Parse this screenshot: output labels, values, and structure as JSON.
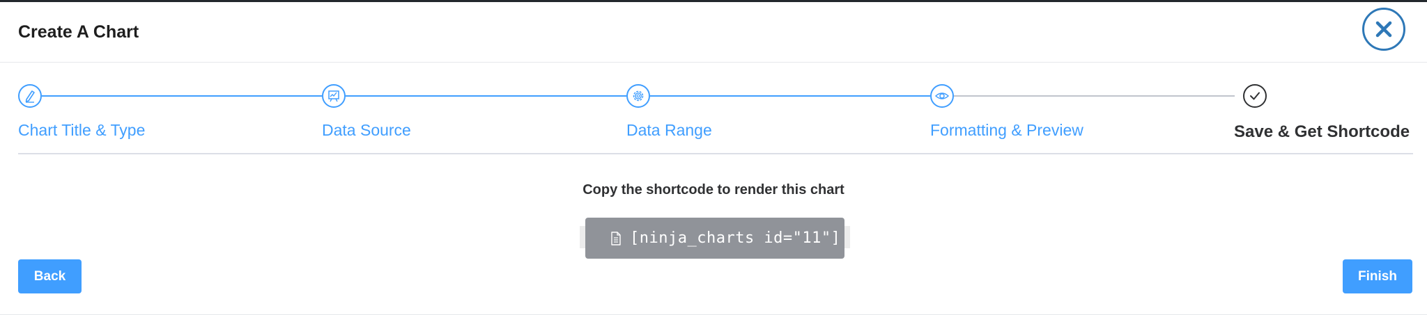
{
  "dialog": {
    "title": "Create A Chart",
    "close_icon": "close-icon",
    "accent_color": "#409eff",
    "close_color": "#2e78b7"
  },
  "steps": [
    {
      "label": "Chart Title & Type",
      "icon": "pencil-icon",
      "status": "complete"
    },
    {
      "label": "Data Source",
      "icon": "presentation-chart-icon",
      "status": "complete"
    },
    {
      "label": "Data Range",
      "icon": "gear-icon",
      "status": "complete"
    },
    {
      "label": "Formatting & Preview",
      "icon": "eye-icon",
      "status": "complete"
    },
    {
      "label": "Save & Get Shortcode",
      "icon": "check-circle-icon",
      "status": "current"
    }
  ],
  "content": {
    "copy_label": "Copy the shortcode to render this chart",
    "shortcode": "[ninja_charts id=\"11\"]",
    "shortcode_icon": "document-icon"
  },
  "actions": {
    "back_label": "Back",
    "finish_label": "Finish"
  }
}
